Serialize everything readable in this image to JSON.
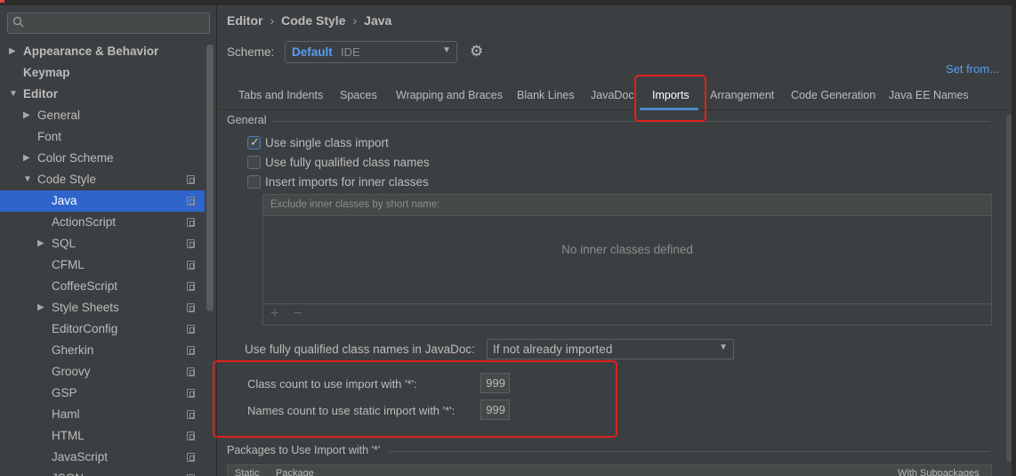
{
  "sidebar": {
    "search": {
      "placeholder": ""
    },
    "items": [
      {
        "label": "Appearance & Behavior"
      },
      {
        "label": "Keymap"
      },
      {
        "label": "Editor"
      },
      {
        "label": "General"
      },
      {
        "label": "Font"
      },
      {
        "label": "Color Scheme"
      },
      {
        "label": "Code Style"
      },
      {
        "label": "Java"
      },
      {
        "label": "ActionScript"
      },
      {
        "label": "SQL"
      },
      {
        "label": "CFML"
      },
      {
        "label": "CoffeeScript"
      },
      {
        "label": "Style Sheets"
      },
      {
        "label": "EditorConfig"
      },
      {
        "label": "Gherkin"
      },
      {
        "label": "Groovy"
      },
      {
        "label": "GSP"
      },
      {
        "label": "Haml"
      },
      {
        "label": "HTML"
      },
      {
        "label": "JavaScript"
      },
      {
        "label": "JSON"
      }
    ]
  },
  "breadcrumb": {
    "part1": "Editor",
    "part2": "Code Style",
    "part3": "Java",
    "sep": "›"
  },
  "scheme": {
    "label": "Scheme:",
    "name": "Default",
    "sub": "IDE"
  },
  "set_from": "Set from...",
  "tabs": [
    {
      "label": "Tabs and Indents"
    },
    {
      "label": "Spaces"
    },
    {
      "label": "Wrapping and Braces"
    },
    {
      "label": "Blank Lines"
    },
    {
      "label": "JavaDoc"
    },
    {
      "label": "Imports"
    },
    {
      "label": "Arrangement"
    },
    {
      "label": "Code Generation"
    },
    {
      "label": "Java EE Names"
    }
  ],
  "general": {
    "title": "General",
    "options": [
      {
        "label": "Use single class import",
        "checked": true
      },
      {
        "label": "Use fully qualified class names",
        "checked": false
      },
      {
        "label": "Insert imports for inner classes",
        "checked": false
      }
    ]
  },
  "exclude": {
    "header": "Exclude inner classes by short name:",
    "empty": "No inner classes defined",
    "add": "+",
    "remove": "−"
  },
  "javadoc": {
    "label": "Use fully qualified class names in JavaDoc:",
    "value": "If not already imported"
  },
  "counts": {
    "class_label": "Class count to use import with '*':",
    "class_value": "999",
    "names_label": "Names count to use static import with '*':",
    "names_value": "999"
  },
  "packages": {
    "title": "Packages to Use Import with '*'",
    "col_static": "Static",
    "col_package": "Package",
    "col_with": "With Subpackages"
  },
  "colors": {
    "accent": "#2f65ca",
    "link": "#589df6",
    "highlight": "#e0201c",
    "background": "#3c3f41"
  }
}
